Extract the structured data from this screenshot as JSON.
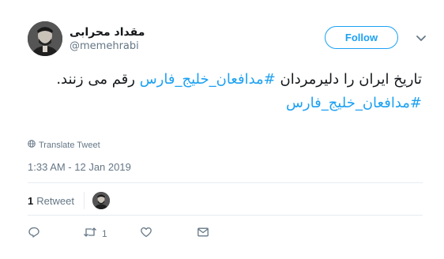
{
  "author": {
    "display_name": "مقداد محرابی",
    "handle": "@memehrabi"
  },
  "follow_label": "Follow",
  "tweet": {
    "text_part1": "تاریخ ایران را دلیرمردان ",
    "hashtag1": "#مدافعان_خلیج_فارس",
    "text_part2": " رقم می زنند.",
    "hashtag2": "#مدافعان_خلیج_فارس"
  },
  "translate_label": "Translate Tweet",
  "timestamp": "1:33 AM - 12 Jan 2019",
  "stats": {
    "retweet_count": "1",
    "retweet_label": "Retweet"
  },
  "actions": {
    "retweet_count": "1"
  },
  "colors": {
    "accent": "#1da1f2",
    "muted": "#657786",
    "divider": "#e6ecf0"
  }
}
